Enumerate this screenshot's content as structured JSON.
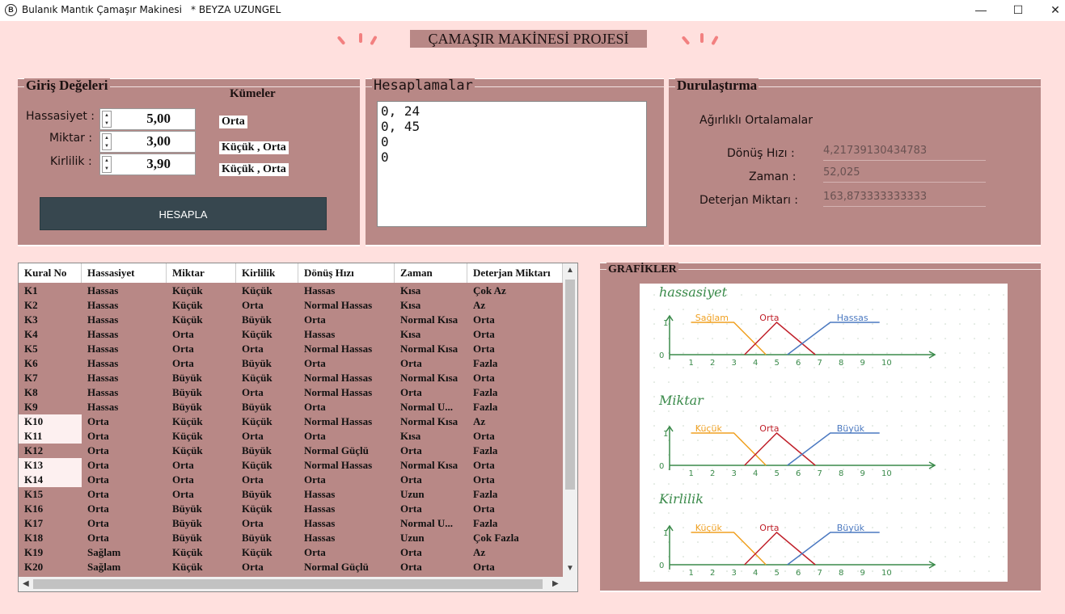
{
  "window": {
    "title": "Bulanık Mantık Çamaşır Makinesi",
    "subtitle": "* BEYZA UZUNGEL",
    "icon": "B",
    "minimize": "—",
    "maximize": "☐",
    "close": "✕"
  },
  "header": {
    "title": "ÇAMAŞIR MAKİNESİ PROJESİ"
  },
  "inputs": {
    "title": "Giriş Değeleri",
    "sets_title": "Kümeler",
    "rows": [
      {
        "label": "Hassasiyet :",
        "value": "5,00",
        "set": "Orta"
      },
      {
        "label": "Miktar :",
        "value": "3,00",
        "set": "Küçük , Orta"
      },
      {
        "label": "Kirlilik :",
        "value": "3,90",
        "set": "Küçük , Orta"
      }
    ],
    "button": "HESAPLA"
  },
  "calc": {
    "title": "Hesaplamalar",
    "lines": [
      "0, 24",
      "0, 45",
      "0",
      "0"
    ]
  },
  "defuzz": {
    "title": "Durulaştırma",
    "subtitle": "Ağırlıklı Ortalamalar",
    "rows": [
      {
        "label": "Dönüş Hızı :",
        "value": "4,21739130434783"
      },
      {
        "label": "Zaman :",
        "value": "52,025"
      },
      {
        "label": "Deterjan Miktarı :",
        "value": "163,873333333333"
      }
    ]
  },
  "table": {
    "headers": [
      "Kural No",
      "Hassasiyet",
      "Miktar",
      "Kirlilik",
      "Dönüş Hızı",
      "Zaman",
      "Deterjan Miktarı"
    ],
    "rows": [
      [
        "K1",
        "Hassas",
        "Küçük",
        "Küçük",
        "Hassas",
        "Kısa",
        "Çok Az"
      ],
      [
        "K2",
        "Hassas",
        "Küçük",
        "Orta",
        "Normal Hassas",
        "Kısa",
        "Az"
      ],
      [
        "K3",
        "Hassas",
        "Küçük",
        "Büyük",
        "Orta",
        "Normal Kısa",
        "Orta"
      ],
      [
        "K4",
        "Hassas",
        "Orta",
        "Küçük",
        "Hassas",
        "Kısa",
        "Orta"
      ],
      [
        "K5",
        "Hassas",
        "Orta",
        "Orta",
        "Normal Hassas",
        "Normal Kısa",
        "Orta"
      ],
      [
        "K6",
        "Hassas",
        "Orta",
        "Büyük",
        "Orta",
        "Orta",
        "Fazla"
      ],
      [
        "K7",
        "Hassas",
        "Büyük",
        "Küçük",
        "Normal Hassas",
        "Normal Kısa",
        "Orta"
      ],
      [
        "K8",
        "Hassas",
        "Büyük",
        "Orta",
        "Normal Hassas",
        "Orta",
        "Fazla"
      ],
      [
        "K9",
        "Hassas",
        "Büyük",
        "Büyük",
        "Orta",
        "Normal U...",
        "Fazla"
      ],
      [
        "K10",
        "Orta",
        "Küçük",
        "Küçük",
        "Normal Hassas",
        "Normal Kısa",
        "Az"
      ],
      [
        "K11",
        "Orta",
        "Küçük",
        "Orta",
        "Orta",
        "Kısa",
        "Orta"
      ],
      [
        "K12",
        "Orta",
        "Küçük",
        "Büyük",
        "Normal Güçlü",
        "Orta",
        "Fazla"
      ],
      [
        "K13",
        "Orta",
        "Orta",
        "Küçük",
        "Normal Hassas",
        "Normal Kısa",
        "Orta"
      ],
      [
        "K14",
        "Orta",
        "Orta",
        "Orta",
        "Orta",
        "Orta",
        "Orta"
      ],
      [
        "K15",
        "Orta",
        "Orta",
        "Büyük",
        "Hassas",
        "Uzun",
        "Fazla"
      ],
      [
        "K16",
        "Orta",
        "Büyük",
        "Küçük",
        "Hassas",
        "Orta",
        "Orta"
      ],
      [
        "K17",
        "Orta",
        "Büyük",
        "Orta",
        "Hassas",
        "Normal U...",
        "Fazla"
      ],
      [
        "K18",
        "Orta",
        "Büyük",
        "Büyük",
        "Hassas",
        "Uzun",
        "Çok Fazla"
      ],
      [
        "K19",
        "Sağlam",
        "Küçük",
        "Küçük",
        "Orta",
        "Orta",
        "Az"
      ],
      [
        "K20",
        "Sağlam",
        "Küçük",
        "Orta",
        "Normal Güçlü",
        "Orta",
        "Orta"
      ]
    ],
    "highlighted_rows": [
      9,
      10,
      12,
      13
    ]
  },
  "graphs": {
    "title": "GRAFİKLER",
    "charts": [
      {
        "title": "hassasiyet",
        "sets": [
          "Sağlam",
          "Orta",
          "Hassas"
        ]
      },
      {
        "title": "Miktar",
        "sets": [
          "Küçük",
          "Orta",
          "Büyük"
        ]
      },
      {
        "title": "Kirlilik",
        "sets": [
          "Küçük",
          "Orta",
          "Büyük"
        ]
      }
    ],
    "ticks": [
      "1",
      "2",
      "3",
      "4",
      "5",
      "6",
      "7",
      "8",
      "9",
      "10"
    ],
    "y_one": "1",
    "zero": "0",
    "colors": {
      "low": "#f0a020",
      "mid": "#c0202a",
      "high": "#4a78c0",
      "axis": "#3a8a4a"
    }
  }
}
